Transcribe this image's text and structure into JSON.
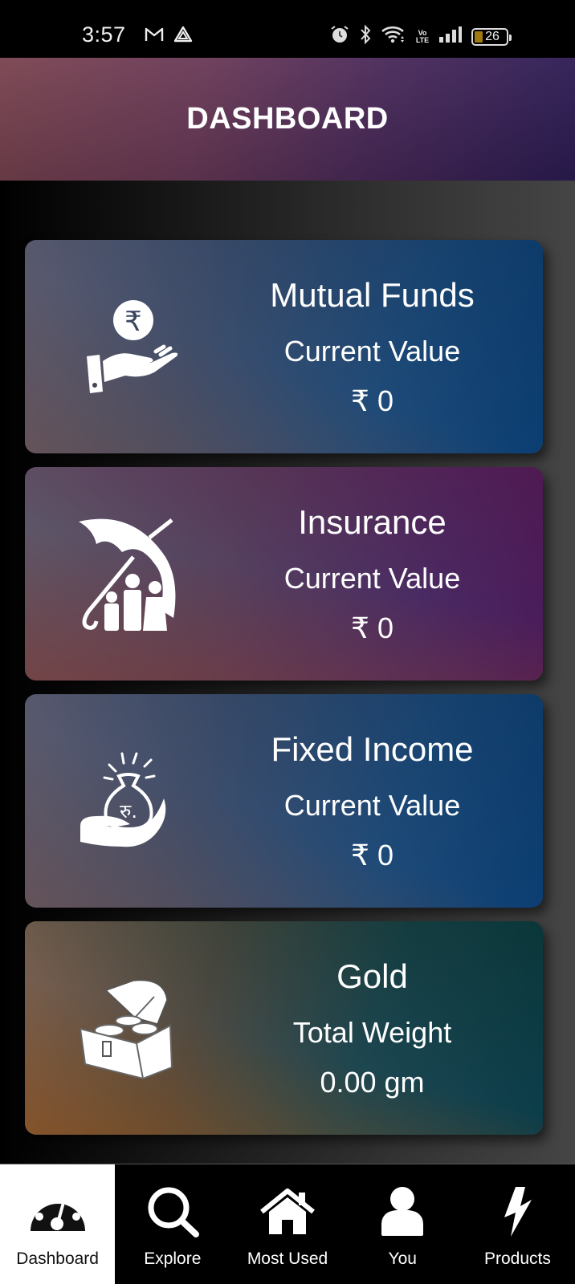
{
  "status_bar": {
    "time": "3:57",
    "left_icons": [
      "gmail-icon",
      "drive-icon"
    ],
    "right_icons": [
      "alarm-icon",
      "bluetooth-icon",
      "wifi-icon",
      "volte-icon",
      "signal-icon",
      "battery-icon"
    ],
    "volte_top": "Vo",
    "volte_bottom": "LTE",
    "battery_level": 26,
    "battery_text": "26",
    "battery_color": "#a07a10"
  },
  "header": {
    "title": "DASHBOARD"
  },
  "cards": [
    {
      "id": "mutual-funds",
      "icon": "hand-rupee-coin-icon",
      "title": "Mutual Funds",
      "subtitle": "Current Value",
      "value": "₹ 0"
    },
    {
      "id": "insurance",
      "icon": "umbrella-family-icon",
      "title": "Insurance",
      "subtitle": "Current Value",
      "value": "₹ 0"
    },
    {
      "id": "fixed-income",
      "icon": "hand-money-bag-icon",
      "title": "Fixed Income",
      "subtitle": "Current Value",
      "value": "₹ 0"
    },
    {
      "id": "gold",
      "icon": "treasure-chest-icon",
      "title": "Gold",
      "subtitle": "Total Weight",
      "value": "0.00 gm"
    }
  ],
  "bottom_nav": {
    "active": "Dashboard",
    "items": [
      {
        "label": "Dashboard",
        "icon": "speedometer-icon"
      },
      {
        "label": "Explore",
        "icon": "search-icon"
      },
      {
        "label": "Most Used",
        "icon": "home-icon"
      },
      {
        "label": "You",
        "icon": "user-icon"
      },
      {
        "label": "Products",
        "icon": "lightning-icon"
      }
    ]
  }
}
